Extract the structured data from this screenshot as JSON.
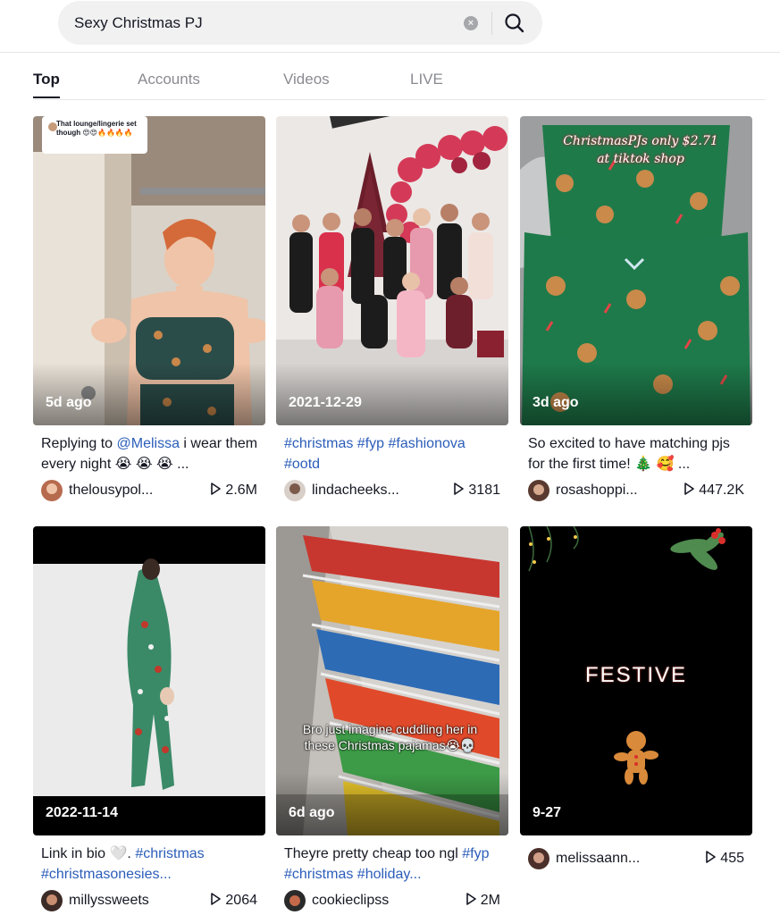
{
  "search": {
    "query": "Sexy Christmas PJ"
  },
  "tabs": [
    {
      "label": "Top",
      "active": true
    },
    {
      "label": "Accounts",
      "active": false
    },
    {
      "label": "Videos",
      "active": false
    },
    {
      "label": "LIVE",
      "active": false
    }
  ],
  "videos": [
    {
      "date": "5d ago",
      "desc_prefix": "Replying to ",
      "mention": "@Melissa",
      "desc_suffix": " i wear them every night 😭 😭 😭 ...",
      "overlay": "That lounge/lingerie set though 😍😍🔥🔥🔥🔥",
      "username": "thelousypol...",
      "views": "2.6M"
    },
    {
      "date": "2021-12-29",
      "hashtags": "#christmas #fyp #fashionova #ootd",
      "username": "lindacheeks...",
      "views": "3181"
    },
    {
      "date": "3d ago",
      "desc": "So excited to have matching pjs for the first time! 🎄 🥰 ...",
      "overlay": "ChristmasPJs only $2.71 at tiktok shop",
      "username": "rosashoppi...",
      "views": "447.2K"
    },
    {
      "date": "2022-11-14",
      "desc_prefix": "Link in bio 🤍. ",
      "hashtags": "#christmas #christmasonesies...",
      "username": "millyssweets",
      "views": "2064"
    },
    {
      "date": "6d ago",
      "desc_prefix": "Theyre pretty cheap too ngl ",
      "hashtags": "#fyp #christmas #holiday...",
      "overlay": "Bro just imagine cuddling her in these Christmas pajamas😭💀",
      "username": "cookieclipss",
      "views": "2M"
    },
    {
      "date": "9-27",
      "overlay": "FESTIVE",
      "username": "melissaann...",
      "views": "455"
    }
  ],
  "colors": {
    "hashtag": "#2b5db9",
    "text": "#161823",
    "muted": "#8a8b91"
  },
  "icons": {
    "search": "search-icon",
    "clear": "clear-icon",
    "play": "play-icon"
  }
}
